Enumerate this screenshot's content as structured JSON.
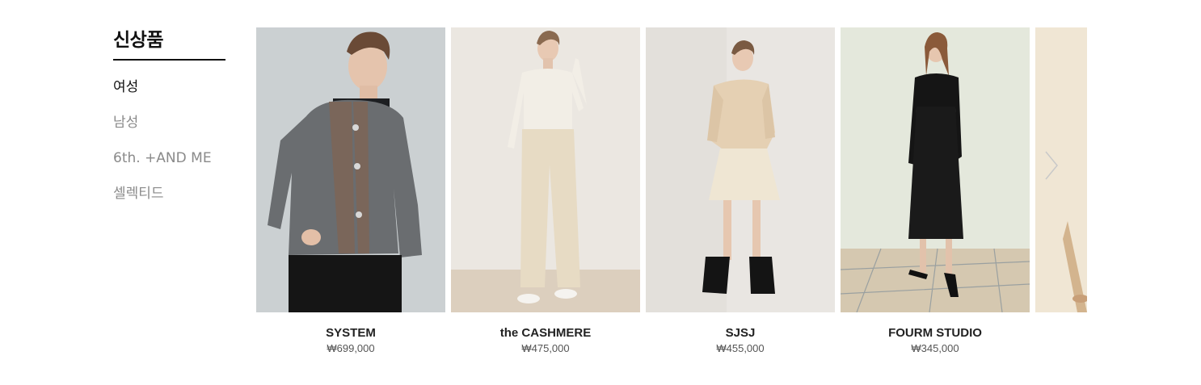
{
  "sidebar": {
    "title": "신상품",
    "items": [
      {
        "label": "여성",
        "active": true
      },
      {
        "label": "남성",
        "active": false
      },
      {
        "label": "6th. +AND ME",
        "active": false
      },
      {
        "label": "셀렉티드",
        "active": false
      }
    ]
  },
  "products": [
    {
      "brand": "SYSTEM",
      "price": "₩699,000",
      "image": "gray-tweed-jacket-photo"
    },
    {
      "brand": "the CASHMERE",
      "price": "₩475,000",
      "image": "cream-knit-wide-pants-photo"
    },
    {
      "brand": "SJSJ",
      "price": "₩455,000",
      "image": "beige-quilted-jacket-skirt-photo"
    },
    {
      "brand": "FOURM STUDIO",
      "price": "₩345,000",
      "image": "black-knit-dress-photo"
    },
    {
      "brand": "",
      "price": "",
      "image": "partial-beige-photo"
    }
  ],
  "carousel": {
    "next_icon": "chevron-right-icon"
  },
  "colors": {
    "text": "#111111",
    "muted": "#8a8a8a",
    "price": "#555555"
  }
}
